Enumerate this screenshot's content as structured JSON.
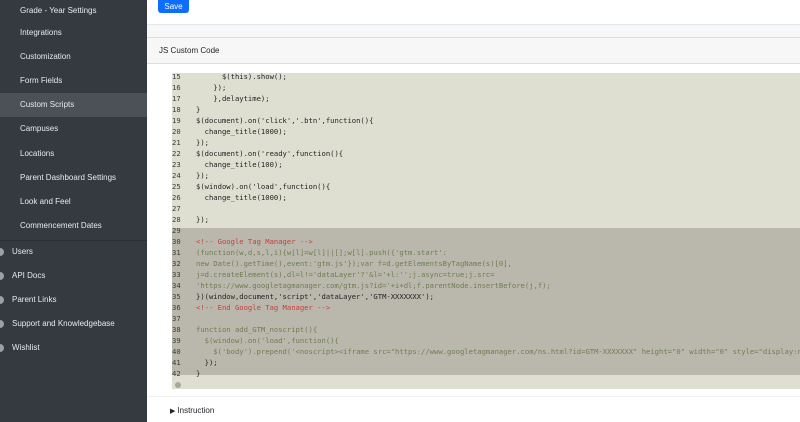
{
  "sidebar": {
    "sub_items": [
      {
        "label": "Grade - Year Settings",
        "active": false
      },
      {
        "label": "Integrations",
        "active": false
      },
      {
        "label": "Customization",
        "active": false
      },
      {
        "label": "Form Fields",
        "active": false
      },
      {
        "label": "Custom Scripts",
        "active": true
      },
      {
        "label": "Campuses",
        "active": false
      },
      {
        "label": "Locations",
        "active": false
      },
      {
        "label": "Parent Dashboard Settings",
        "active": false
      },
      {
        "label": "Look and Feel",
        "active": false
      },
      {
        "label": "Commencement Dates",
        "active": false
      }
    ],
    "main_items": [
      {
        "label": "Users",
        "icon": "users-icon"
      },
      {
        "label": "API Docs",
        "icon": "api-docs-icon"
      },
      {
        "label": "Parent Links",
        "icon": "link-icon"
      },
      {
        "label": "Support and Knowledgebase",
        "icon": "support-icon"
      },
      {
        "label": "Wishlist",
        "icon": "wishlist-icon"
      }
    ]
  },
  "toolbar": {
    "save_label": "Save"
  },
  "card": {
    "title": "JS Custom Code"
  },
  "editor": {
    "lines": [
      {
        "n": "15",
        "t": "      $(this).show();",
        "kind": "normal"
      },
      {
        "n": "16",
        "t": "    });",
        "kind": "normal"
      },
      {
        "n": "17",
        "t": "    },delaytime);",
        "kind": "normal"
      },
      {
        "n": "18",
        "t": "}",
        "kind": "normal"
      },
      {
        "n": "19",
        "t": "$(document).on('click','.btn',function(){",
        "kind": "normal"
      },
      {
        "n": "20",
        "t": "  change_title(1000);",
        "kind": "normal"
      },
      {
        "n": "21",
        "t": "});",
        "kind": "normal"
      },
      {
        "n": "22",
        "t": "$(document).on('ready',function(){",
        "kind": "normal"
      },
      {
        "n": "23",
        "t": "  change_title(100);",
        "kind": "normal"
      },
      {
        "n": "24",
        "t": "});",
        "kind": "normal"
      },
      {
        "n": "25",
        "t": "$(window).on('load',function(){",
        "kind": "normal"
      },
      {
        "n": "26",
        "t": "  change_title(1000);",
        "kind": "normal"
      },
      {
        "n": "27",
        "t": "",
        "kind": "normal"
      },
      {
        "n": "28",
        "t": "});",
        "kind": "normal"
      },
      {
        "n": "29",
        "t": "",
        "kind": "selected"
      },
      {
        "n": "30",
        "t": "<!-- Google Tag Manager -->",
        "kind": "comment"
      },
      {
        "n": "31",
        "t": "(function(w,d,s,l,i){w[l]=w[l]||[];w[l].push({'gtm.start':",
        "kind": "faded"
      },
      {
        "n": "32",
        "t": "new Date().getTime(),event:'gtm.js'});var f=d.getElementsByTagName(s)[0],",
        "kind": "faded"
      },
      {
        "n": "33",
        "t": "j=d.createElement(s),dl=l!='dataLayer'?'&l='+l:'';j.async=true;j.src=",
        "kind": "faded"
      },
      {
        "n": "34",
        "t": "'https://www.googletagmanager.com/gtm.js?id='+i+dl;f.parentNode.insertBefore(j,f);",
        "kind": "faded"
      },
      {
        "n": "35",
        "t": "})(window,document,'script','dataLayer','GTM-XXXXXXX');",
        "kind": "normal"
      },
      {
        "n": "36",
        "t": "<!-- End Google Tag Manager -->",
        "kind": "comment"
      },
      {
        "n": "37",
        "t": "",
        "kind": "selected"
      },
      {
        "n": "38",
        "t": "function add_GTM_noscript(){",
        "kind": "faded"
      },
      {
        "n": "39",
        "t": "  $(window).on('load',function(){",
        "kind": "faded"
      },
      {
        "n": "40",
        "t": "    $('body').prepend('<noscript><iframe src=\"https://www.googletagmanager.com/ns.html?id=GTM-XXXXXXX\" height=\"0\" width=\"0\" style=\"display:none;visibility:hidden\"></iframe></noscript>');",
        "kind": "faded"
      },
      {
        "n": "41",
        "t": "  });",
        "kind": "normal"
      },
      {
        "n": "42",
        "t": "}",
        "kind": "normal"
      }
    ]
  },
  "instruction": {
    "label": "Instruction",
    "marker": "▶"
  }
}
